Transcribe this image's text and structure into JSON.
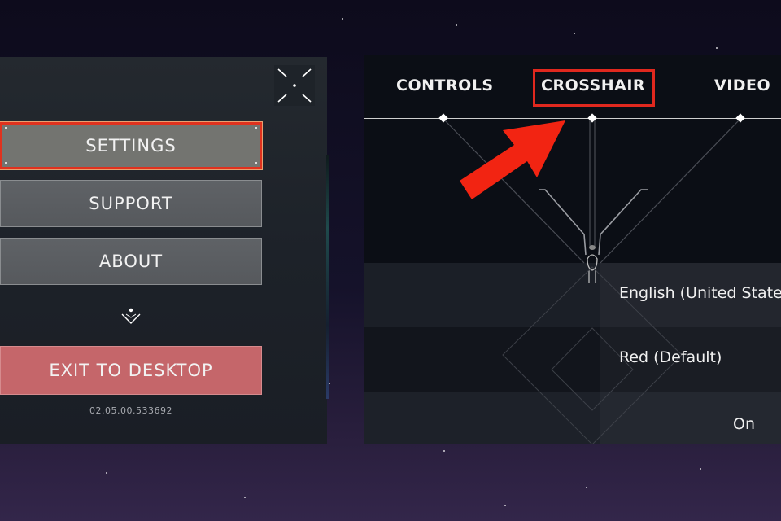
{
  "left_menu": {
    "items": [
      {
        "label": "SETTINGS",
        "state": "highlighted"
      },
      {
        "label": "SUPPORT"
      },
      {
        "label": "ABOUT"
      }
    ],
    "exit_label": "EXIT TO DESKTOP",
    "version": "02.05.00.533692",
    "collapse_icon": "collapse-icon",
    "expand_more_icon": "chevron-down-icon"
  },
  "settings_panel": {
    "tabs": [
      {
        "label": "CONTROLS"
      },
      {
        "label": "CROSSHAIR",
        "state": "highlighted"
      },
      {
        "label": "VIDEO"
      }
    ],
    "rows": [
      {
        "value": "English (United States"
      },
      {
        "value": "Red (Default)"
      },
      {
        "value": "On"
      }
    ]
  },
  "annotation": {
    "arrow_icon": "red-arrow-icon",
    "highlight_color": "#e0281e"
  },
  "colors": {
    "exit_button": "#c5666a",
    "highlight": "#e0321e"
  }
}
